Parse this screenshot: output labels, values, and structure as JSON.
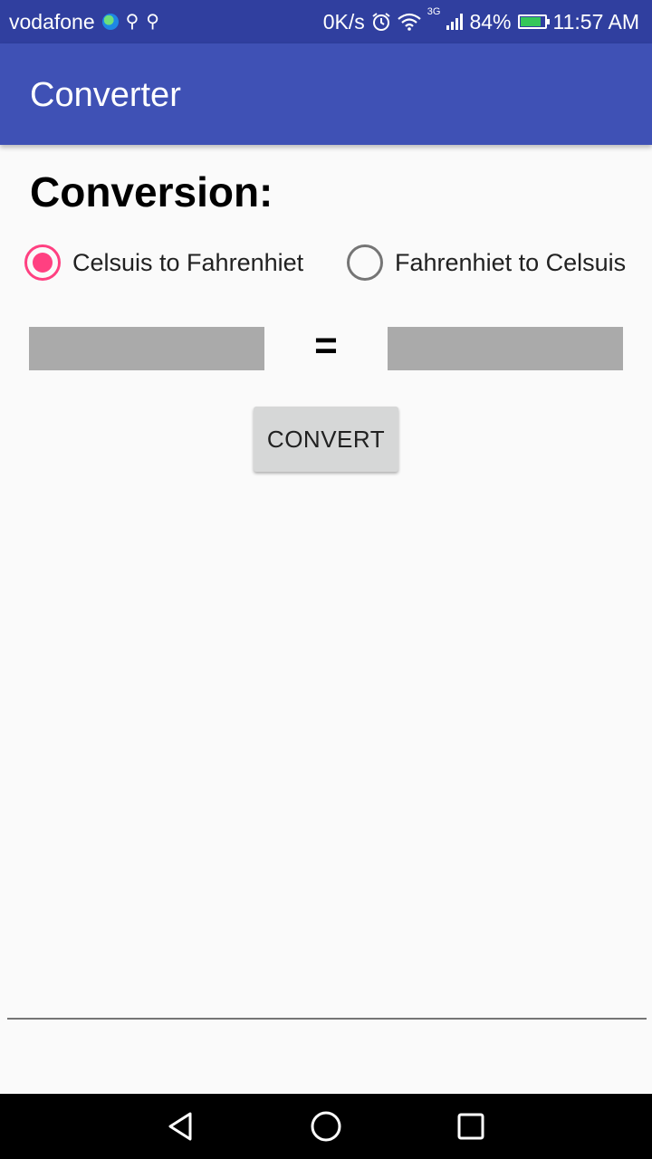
{
  "status_bar": {
    "carrier": "vodafone",
    "net_speed": "0K/s",
    "network_type": "3G",
    "battery": "84%",
    "time": "11:57 AM",
    "icons": [
      "globe-icon",
      "usb-icon",
      "usb-icon",
      "alarm-icon",
      "wifi-icon",
      "signal-icon",
      "battery-icon"
    ]
  },
  "app_bar": {
    "title": "Converter"
  },
  "main": {
    "heading": "Conversion:",
    "radio_options": [
      {
        "label": "Celsuis to Fahrenhiet",
        "checked": true
      },
      {
        "label": "Fahrenhiet to Celsuis",
        "checked": false
      }
    ],
    "input_field": {
      "value": "",
      "placeholder": ""
    },
    "equals_sign": "=",
    "output_field": {
      "value": "",
      "placeholder": ""
    },
    "convert_label": "CONVERT"
  },
  "nav_bar": {
    "icons": [
      "back-icon",
      "home-icon",
      "recents-icon"
    ]
  },
  "colors": {
    "status_bar": "#303f9f",
    "app_bar": "#3f51b5",
    "accent": "#ff4081",
    "field_background": "#aaaaaa",
    "button_background": "#d6d7d7"
  }
}
